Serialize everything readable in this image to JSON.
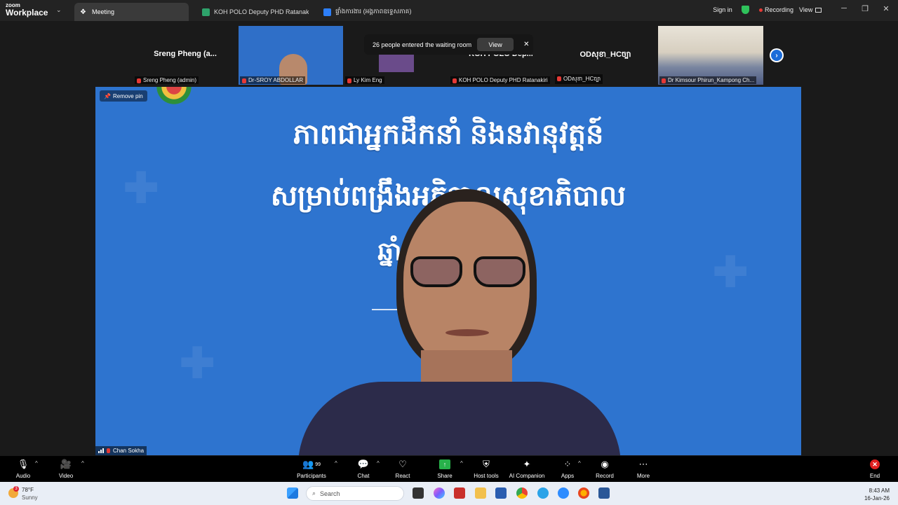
{
  "app": {
    "brand_top": "zoom",
    "brand_bottom": "Workplace"
  },
  "tabs": [
    {
      "label": "Meeting",
      "color": "#ffffff"
    },
    {
      "label": "KOH POLO Deputy PHD Ratanakiri's sc",
      "color": "#2ea36b"
    },
    {
      "label": "ផ្ទាំងការងារ (អង្គភាពឧទ្ទេសភាគ)",
      "color": "#2d7ff9"
    }
  ],
  "header": {
    "sign_in": "Sign in",
    "recording": "Recording",
    "view": "View"
  },
  "participants_strip": [
    {
      "display_name": "Sreng Pheng (a...",
      "label": "Sreng Pheng (admin)"
    },
    {
      "display_name": "",
      "label": "Dr-SROY ABDOLLAR"
    },
    {
      "display_name": "",
      "label": "Ly Kim Eng"
    },
    {
      "display_name": "KOH POLO Dep...",
      "label": "KOH POLO Deputy PHD Ratanakiri"
    },
    {
      "display_name": "ODសុខា_HCច្បា",
      "label": "ODសុខា_HCច្បា"
    },
    {
      "display_name": "",
      "label": "Dr Kimsour Phirun_Kampong Ch..."
    }
  ],
  "toast": {
    "message": "26 people entered the waiting room",
    "action": "View",
    "close": "✕"
  },
  "main_video": {
    "pin_label": "Remove pin",
    "speaker_name": "Chan Sokha",
    "slide_lines": [
      "ភាពជាអ្នកដឹកនាំ និងនវានុវត្តន៍",
      "សម្រាប់ពង្រឹងអភិបាលសុខាភិបាល",
      "ឆ្នាំ ២"
    ]
  },
  "toolbar": {
    "audio": "Audio",
    "video": "Video",
    "participants": "Participants",
    "participants_count": "99",
    "chat": "Chat",
    "react": "React",
    "share": "Share",
    "host_tools": "Host tools",
    "ai_companion": "AI Companion",
    "apps": "Apps",
    "record": "Record",
    "more": "More",
    "end": "End"
  },
  "taskbar": {
    "temperature": "78°F",
    "condition": "Sunny",
    "weather_badge": "3",
    "search_placeholder": "Search",
    "time": "8:43 AM",
    "date": "16-Jan-26"
  },
  "colors": {
    "accent": "#1b6cd9",
    "slide_blue": "#2e74cf",
    "end_red": "#e02020",
    "share_green": "#27b14a"
  }
}
